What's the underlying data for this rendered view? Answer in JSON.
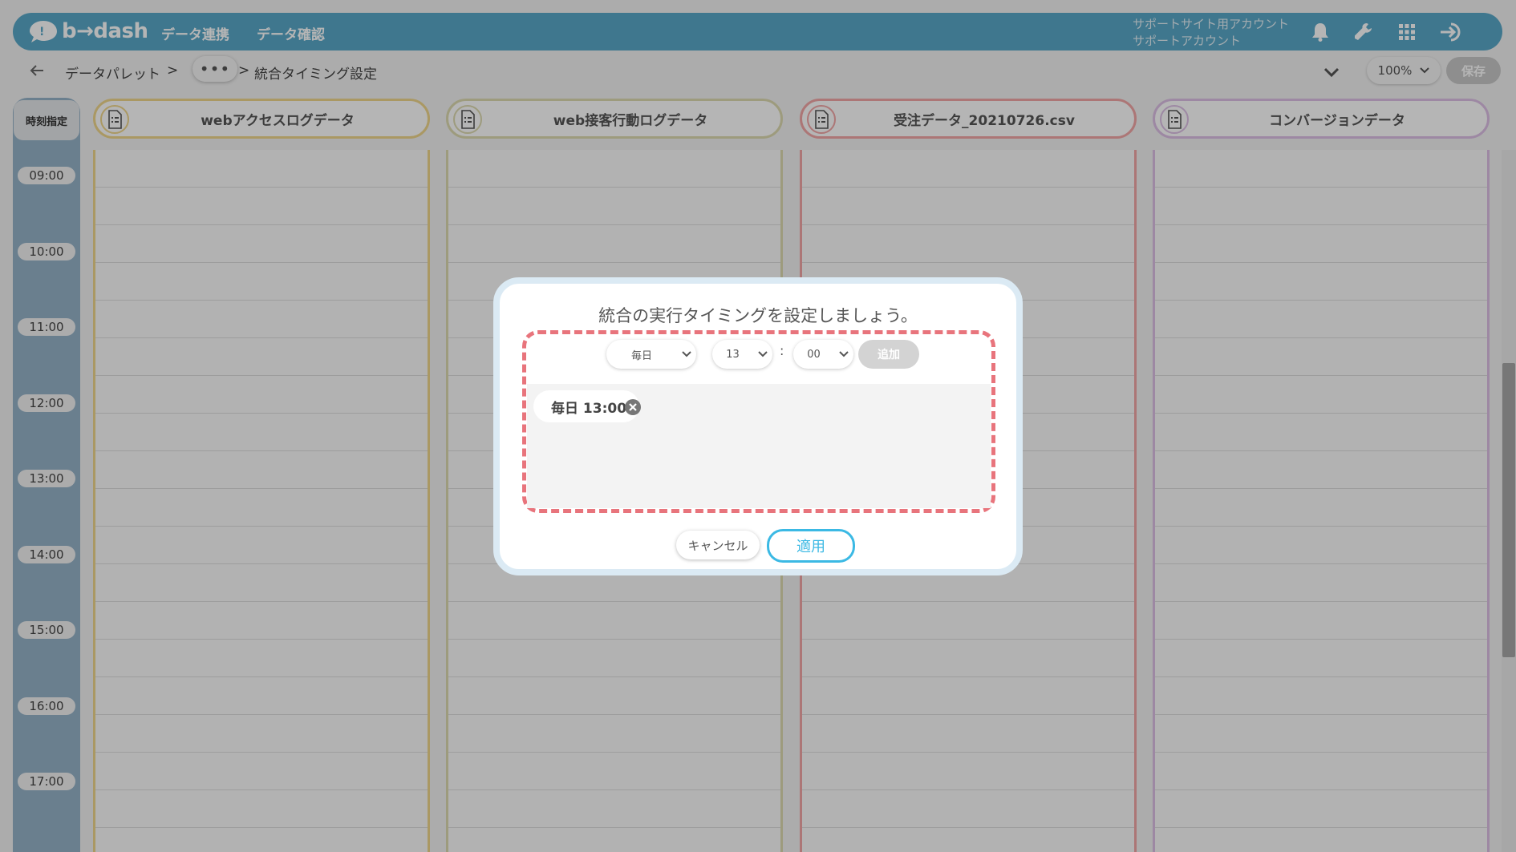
{
  "app": {
    "logo_text": "b→dash"
  },
  "nav": {
    "items": [
      "データ連携",
      "データ確認"
    ]
  },
  "account": {
    "line1": "サポートサイト用アカウント",
    "line2": "サポートアカウント"
  },
  "breadcrumb": {
    "root": "データパレット",
    "sep1": ">",
    "more": "•••",
    "sep2": ">",
    "current": "統合タイミング設定"
  },
  "toolbar": {
    "zoom": "100%",
    "save": "保存"
  },
  "time_header": "時刻指定",
  "ticks": [
    "09:00",
    "10:00",
    "11:00",
    "12:00",
    "13:00",
    "14:00",
    "15:00",
    "16:00",
    "17:00"
  ],
  "columns": [
    {
      "title": "webアクセスログデータ",
      "color": "#f0d78c"
    },
    {
      "title": "web接客行動ログデータ",
      "color": "#dedbb0"
    },
    {
      "title": "受注データ_20210726.csv",
      "color": "#f2a6a6"
    },
    {
      "title": "コンバージョンデータ",
      "color": "#ddc0e6"
    }
  ],
  "modal": {
    "title": "統合の実行タイミングを設定しましょう。",
    "frequency": "毎日",
    "hour": "13",
    "colon": ":",
    "minute": "00",
    "add": "追加",
    "chip": "毎日 13:00",
    "cancel": "キャンセル",
    "apply": "適用"
  },
  "colors": {
    "header": "#59a8c8",
    "accent": "#3bb9e4",
    "highlight": "#e8747c"
  }
}
